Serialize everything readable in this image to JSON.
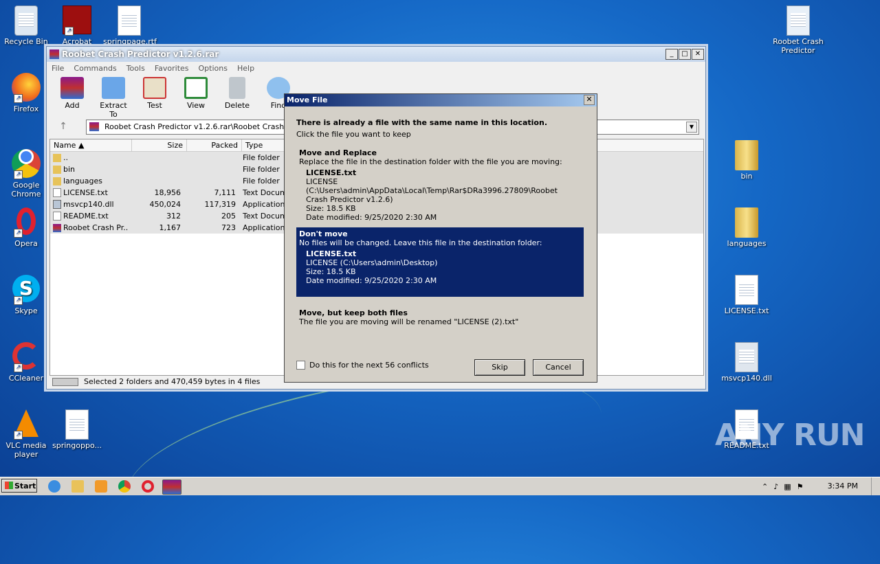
{
  "desktop": {
    "icons_left": [
      {
        "label": "Recycle Bin",
        "icon": "recycle-bin-icon"
      },
      {
        "label": "Acrobat",
        "icon": "acrobat-icon"
      },
      {
        "label": "springpage.rtf",
        "icon": "word-doc-icon"
      },
      {
        "label": "Firefox",
        "icon": "firefox-icon"
      },
      {
        "label": "Google Chrome",
        "icon": "chrome-icon"
      },
      {
        "label": "Opera",
        "icon": "opera-icon"
      },
      {
        "label": "Skype",
        "icon": "skype-icon"
      },
      {
        "label": "CCleaner",
        "icon": "ccleaner-icon"
      },
      {
        "label": "VLC media player",
        "icon": "vlc-icon"
      },
      {
        "label": "springoppo...",
        "icon": "word-doc-icon"
      }
    ],
    "icons_right": [
      {
        "label": "Roobet Crash Predictor",
        "icon": "app-icon"
      },
      {
        "label": "bin",
        "icon": "folder-icon"
      },
      {
        "label": "languages",
        "icon": "folder-icon"
      },
      {
        "label": "LICENSE.txt",
        "icon": "text-file-icon"
      },
      {
        "label": "msvcp140.dll",
        "icon": "dll-file-icon"
      },
      {
        "label": "README.txt",
        "icon": "text-file-icon"
      }
    ],
    "watermark": "ANY RUN"
  },
  "winrar": {
    "title": "Roobet Crash Predictor v1.2.6.rar",
    "menu": [
      "File",
      "Commands",
      "Tools",
      "Favorites",
      "Options",
      "Help"
    ],
    "toolbar": [
      "Add",
      "Extract To",
      "Test",
      "View",
      "Delete",
      "Find"
    ],
    "address": "Roobet Crash Predictor v1.2.6.rar\\Roobet Crash Predic",
    "columns": [
      "Name",
      "Size",
      "Packed",
      "Type"
    ],
    "rows": [
      {
        "name": "..",
        "size": "",
        "packed": "",
        "type": "File folder",
        "icon": "folder-up-icon"
      },
      {
        "name": "bin",
        "size": "",
        "packed": "",
        "type": "File folder",
        "icon": "folder-icon"
      },
      {
        "name": "languages",
        "size": "",
        "packed": "",
        "type": "File folder",
        "icon": "folder-icon"
      },
      {
        "name": "LICENSE.txt",
        "size": "18,956",
        "packed": "7,111",
        "type": "Text Docum",
        "icon": "text-file-icon"
      },
      {
        "name": "msvcp140.dll",
        "size": "450,024",
        "packed": "117,319",
        "type": "Application",
        "icon": "dll-file-icon"
      },
      {
        "name": "README.txt",
        "size": "312",
        "packed": "205",
        "type": "Text Docum",
        "icon": "text-file-icon"
      },
      {
        "name": "Roobet Crash Pr...",
        "size": "1,167",
        "packed": "723",
        "type": "Application",
        "icon": "rar-file-icon"
      }
    ],
    "status": "Selected 2 folders and 470,459 bytes in 4 files"
  },
  "dialog": {
    "title": "Move File",
    "heading": "There is already a file with the same name in this location.",
    "subheading": "Click the file you want to keep",
    "replace": {
      "title": "Move and Replace",
      "desc": "Replace the file in the destination folder with the file you are moving:",
      "file": "LICENSE.txt",
      "path1": "LICENSE (C:\\Users\\admin\\AppData\\Local\\Temp\\Rar$DRa3996.27809\\Roobet",
      "path2": "Crash Predictor v1.2.6)",
      "size": "Size: 18.5 KB",
      "date": "Date modified: 9/25/2020 2:30 AM"
    },
    "dontmove": {
      "title": "Don't move",
      "desc": "No files will be changed. Leave this file in the destination folder:",
      "file": "LICENSE.txt",
      "path": "LICENSE (C:\\Users\\admin\\Desktop)",
      "size": "Size: 18.5 KB",
      "date": "Date modified: 9/25/2020 2:30 AM"
    },
    "keepboth": {
      "title": "Move, but keep both files",
      "desc": "The file you are moving will be renamed \"LICENSE (2).txt\""
    },
    "checkbox": "Do this for the next 56 conflicts",
    "skip": "Skip",
    "cancel": "Cancel"
  },
  "taskbar": {
    "start": "Start",
    "clock": "3:34 PM"
  }
}
